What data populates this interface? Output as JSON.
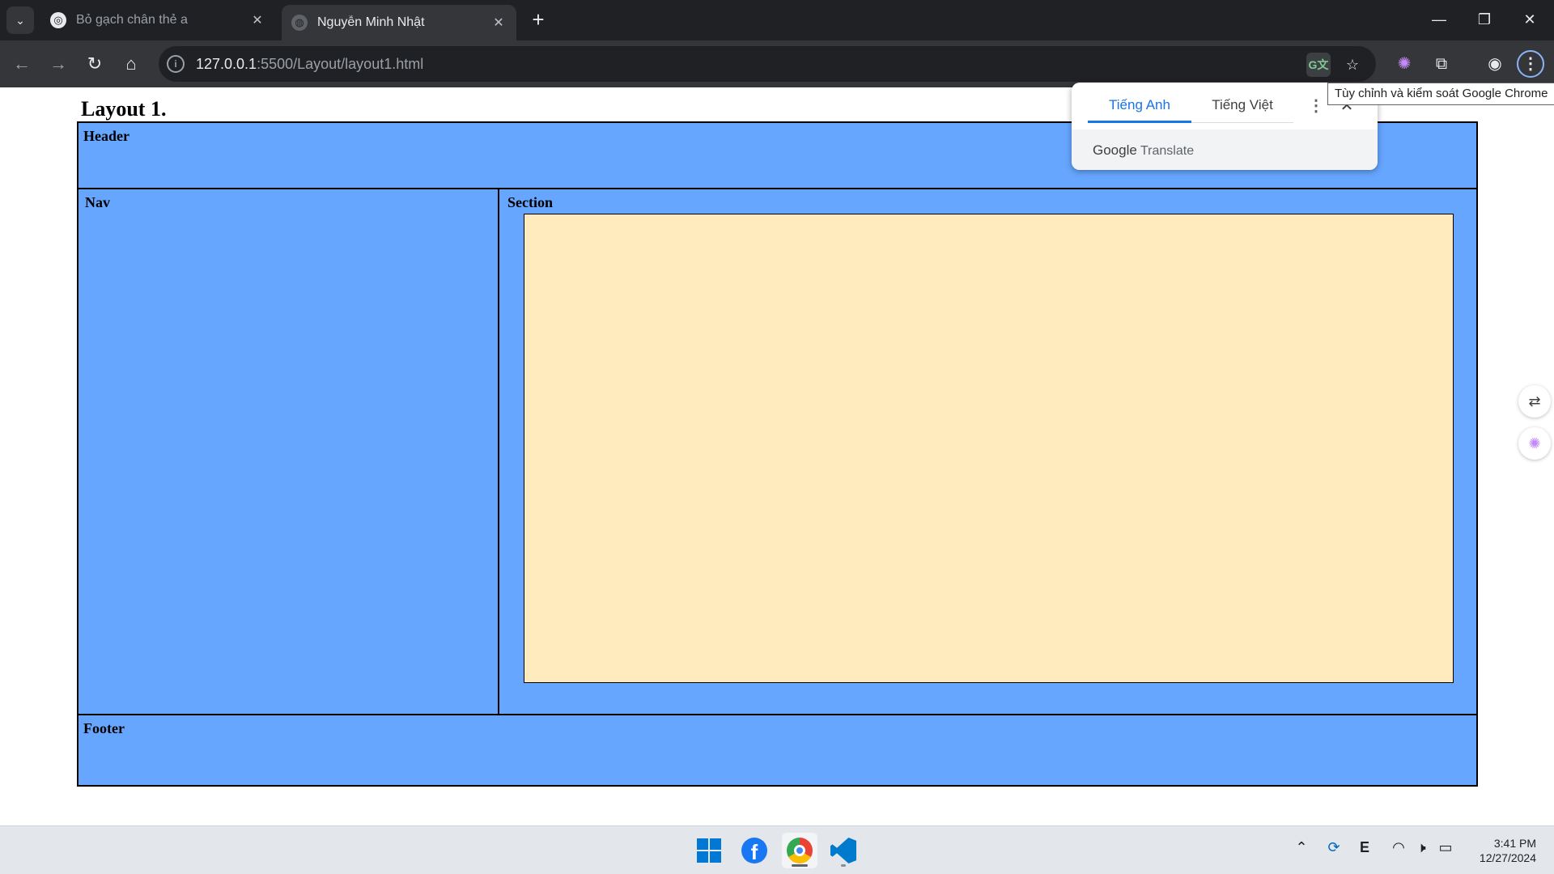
{
  "browser": {
    "tabs": [
      {
        "title": "Bỏ gạch chân thẻ a",
        "close": "✕"
      },
      {
        "title": "Nguyễn Minh Nhật",
        "close": "✕"
      }
    ],
    "new_tab": "+",
    "url_host": "127.0.0.1",
    "url_path": ":5500/Layout/layout1.html",
    "window_controls": {
      "minimize": "—",
      "maximize": "❐",
      "close": "✕"
    }
  },
  "page": {
    "title": "Layout 1.",
    "header_label": "Header",
    "nav_label": "Nav",
    "section_label": "Section",
    "footer_label": "Footer",
    "colors": {
      "box": "#66a6ff",
      "content": "#ffebbe"
    }
  },
  "translate_popup": {
    "tabs": [
      "Tiếng Anh",
      "Tiếng Việt"
    ],
    "active_tab": "Tiếng Anh",
    "brand_google": "Google",
    "brand_translate": "Translate"
  },
  "tooltip": "Tùy chỉnh và kiểm soát Google Chrome",
  "taskbar": {
    "apps": [
      "windows-start",
      "facebook",
      "chrome",
      "vscode"
    ],
    "tray_letter": "E",
    "time": "3:41 PM",
    "date": "12/27/2024"
  }
}
